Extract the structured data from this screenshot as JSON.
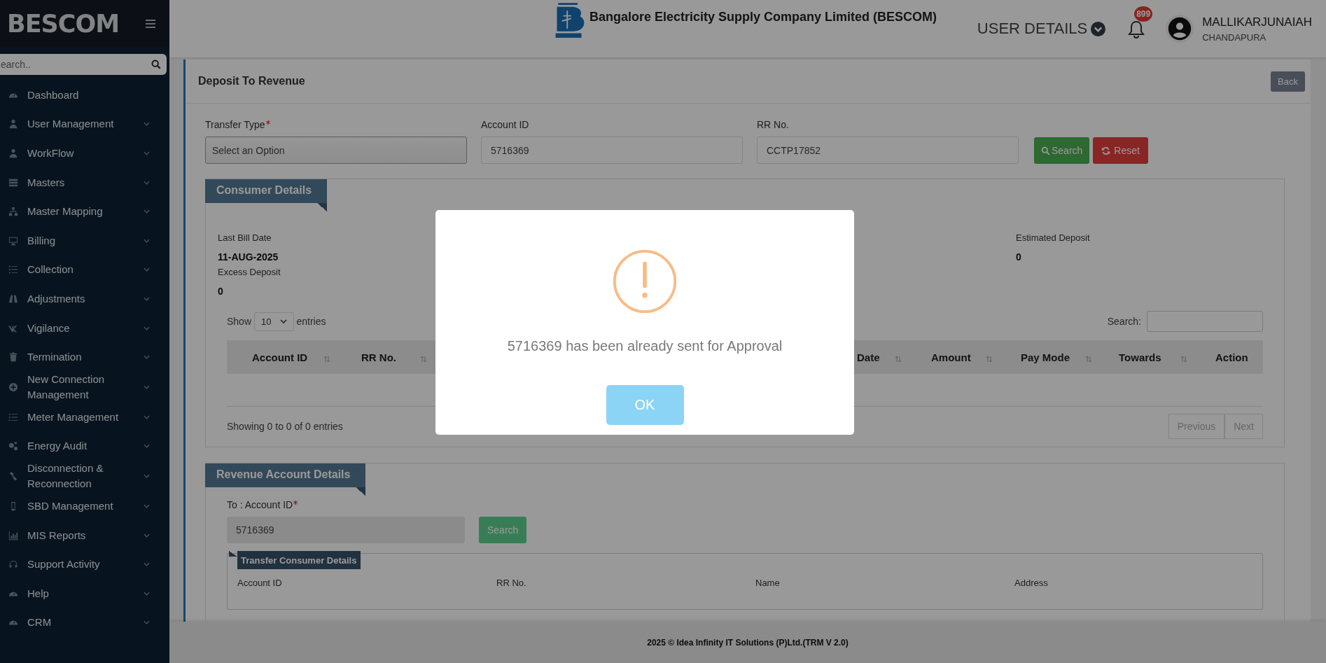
{
  "sidebar": {
    "brand": "BESCOM",
    "search_placeholder": "earch..",
    "items": [
      {
        "label": "Dashboard",
        "has_submenu": false
      },
      {
        "label": "User Management",
        "has_submenu": true
      },
      {
        "label": "WorkFlow",
        "has_submenu": true
      },
      {
        "label": "Masters",
        "has_submenu": true
      },
      {
        "label": "Master Mapping",
        "has_submenu": true
      },
      {
        "label": "Billing",
        "has_submenu": true
      },
      {
        "label": "Collection",
        "has_submenu": true
      },
      {
        "label": "Adjustments",
        "has_submenu": true
      },
      {
        "label": "Vigilance",
        "has_submenu": true
      },
      {
        "label": "Termination",
        "has_submenu": true
      },
      {
        "label": "New Connection Management",
        "has_submenu": true
      },
      {
        "label": "Meter Management",
        "has_submenu": true
      },
      {
        "label": "Energy Audit",
        "has_submenu": true
      },
      {
        "label": "Disconnection & Reconnection",
        "has_submenu": true
      },
      {
        "label": "SBD Management",
        "has_submenu": true
      },
      {
        "label": "MIS Reports",
        "has_submenu": true
      },
      {
        "label": "Support Activity",
        "has_submenu": true
      },
      {
        "label": "Help",
        "has_submenu": true
      },
      {
        "label": "CRM",
        "has_submenu": true
      }
    ]
  },
  "header": {
    "company": "Bangalore Electricity Supply Company Limited (BESCOM)",
    "user_details": "USER DETAILS",
    "notifications": "899",
    "user_name": "MALLIKARJUNAIAH",
    "user_location": "CHANDAPURA"
  },
  "page": {
    "title": "Deposit To Revenue",
    "back": "Back",
    "filters": [
      {
        "label": "Transfer Type",
        "required": true,
        "kind": "select",
        "value": "Select an Option"
      },
      {
        "label": "Account ID",
        "required": false,
        "kind": "input",
        "value": "5716369"
      },
      {
        "label": "RR No.",
        "required": false,
        "kind": "input",
        "value": "CCTP17852"
      }
    ],
    "search_button": "Search",
    "reset_button": "Reset"
  },
  "consumer_details": {
    "title": "Consumer Details",
    "fields": [
      {
        "label": "Last Bill Date",
        "value": "11-AUG-2025"
      },
      {
        "label": "Estimated Deposit",
        "value": "0"
      },
      {
        "label": "Excess Deposit",
        "value": "0"
      }
    ],
    "show_label": "Show",
    "page_size": "10",
    "entries_label": "entries",
    "search_label": "Search:",
    "columns": [
      {
        "label": "Account ID",
        "sortable": true
      },
      {
        "label": "RR No.",
        "sortable": true
      },
      {
        "label": "Date",
        "sortable": true
      },
      {
        "label": "Amount",
        "sortable": true
      },
      {
        "label": "Pay Mode",
        "sortable": true
      },
      {
        "label": "Towards",
        "sortable": true
      },
      {
        "label": "Action",
        "sortable": false
      }
    ],
    "info": "Showing 0 to 0 of 0 entries",
    "previous": "Previous",
    "next": "Next"
  },
  "revenue_account": {
    "title": "Revenue Account Details",
    "to_label": "To : Account ID",
    "to_required": true,
    "to_value": "5716369",
    "search_button": "Search",
    "transfer_title": "Transfer Consumer Details",
    "transfer_columns": [
      "Account ID",
      "RR No.",
      "Name",
      "Address"
    ]
  },
  "footer": "2025 © Idea Infinity IT Solutions (P)Ltd.(TRM V 2.0)",
  "dialog": {
    "message": "5716369 has been already sent for Approval",
    "ok": "OK"
  }
}
